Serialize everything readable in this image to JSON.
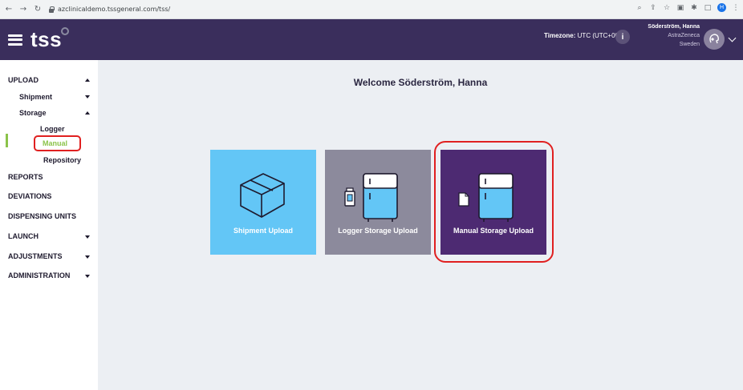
{
  "browser": {
    "url": "azclinicaldemo.tssgeneral.com/tss/",
    "profile_initial": "H"
  },
  "header": {
    "logo_text": "tss",
    "timezone_label": "Timezone:",
    "timezone_value": "UTC (UTC+00:00)",
    "info_glyph": "i",
    "user_name": "Söderström, Hanna",
    "user_org": "AstraZeneca",
    "user_country": "Sweden"
  },
  "sidebar": {
    "upload": "UPLOAD",
    "shipment": "Shipment",
    "storage": "Storage",
    "logger": "Logger",
    "manual": "Manual",
    "repository": "Repository",
    "reports": "REPORTS",
    "deviations": "DEVIATIONS",
    "dispensing_units": "DISPENSING UNITS",
    "launch": "LAUNCH",
    "adjustments": "ADJUSTMENTS",
    "administration": "ADMINISTRATION"
  },
  "main": {
    "welcome": "Welcome Söderström, Hanna",
    "tiles": [
      {
        "label": "Shipment Upload",
        "color": "#63c6f6"
      },
      {
        "label": "Logger Storage Upload",
        "color": "#8c8a9c"
      },
      {
        "label": "Manual Storage Upload",
        "color": "#4d2a72"
      }
    ]
  },
  "colors": {
    "header_bg": "#3a2e5c",
    "active_green": "#8bc34a",
    "highlight_red": "#e02020",
    "main_bg": "#eceff3"
  }
}
